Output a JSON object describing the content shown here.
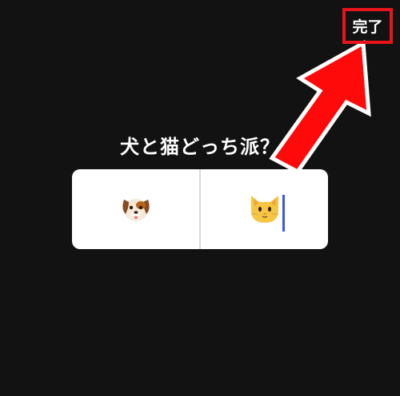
{
  "header": {
    "done_label": "完了"
  },
  "poll": {
    "question": "犬と猫どっち派？",
    "options": [
      {
        "icon": "dog-face-icon"
      },
      {
        "icon": "cat-face-icon"
      }
    ]
  },
  "colors": {
    "background": "#121212",
    "highlight": "#e8141b",
    "cursor": "#3a5bd9"
  }
}
